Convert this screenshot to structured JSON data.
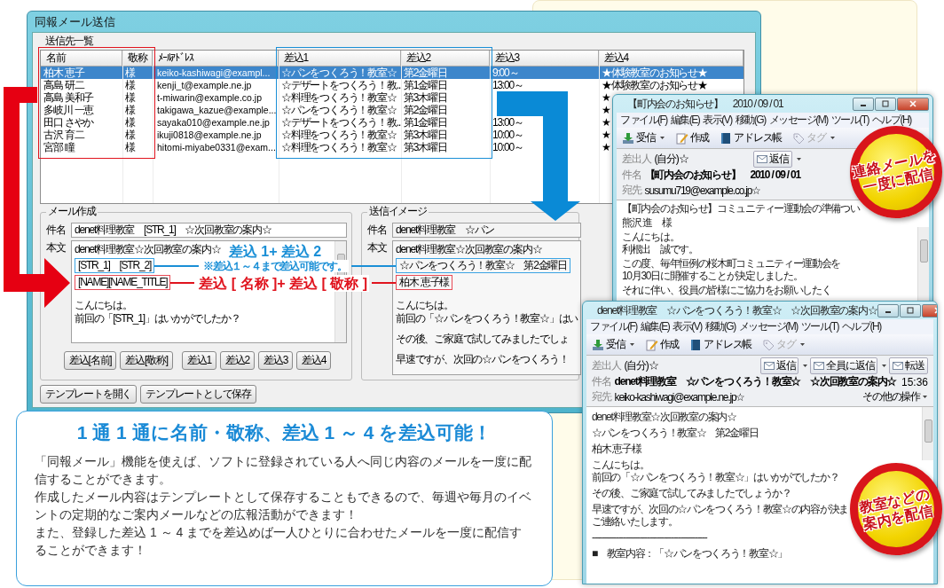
{
  "main_window": {
    "title": "同報メール送信",
    "recipient_list": {
      "label": "送信先一覧",
      "columns": [
        "名前",
        "敬称",
        "ﾒｰﾙｱﾄﾞﾚｽ",
        "差込1",
        "差込2",
        "差込3",
        "差込4"
      ],
      "rows": [
        {
          "selected": true,
          "name": "柏木 恵子",
          "honorific": "様",
          "email": "keiko-kashiwagi@exampl...",
          "insert_1": "☆パンをつくろう！教室☆",
          "insert_2": "第2金曜日",
          "insert_3": "9:00～",
          "insert_4": "★体験教室のお知らせ★"
        },
        {
          "selected": false,
          "name": "高島 研二",
          "honorific": "様",
          "email": "kenji_t@example.ne.jp",
          "insert_1": "☆デザートをつくろう！教...",
          "insert_2": "第1金曜日",
          "insert_3": "13:00～",
          "insert_4": "★体験教室のお知らせ★"
        },
        {
          "selected": false,
          "name": "高島 美和子",
          "honorific": "様",
          "email": "t-miwarin@example.co.jp",
          "insert_1": "☆料理をつくろう！教室☆",
          "insert_2": "第3木曜日",
          "insert_4": "★"
        },
        {
          "selected": false,
          "name": "多岐川 一恵",
          "honorific": "様",
          "email": "takigawa_kazue@example...",
          "insert_1": "☆パンをつくろう！教室☆",
          "insert_2": "第2金曜日",
          "insert_4": "★"
        },
        {
          "selected": false,
          "name": "田口 さやか",
          "honorific": "様",
          "email": "sayaka010@example.ne.jp",
          "insert_1": "☆デザートをつくろう！教...",
          "insert_2": "第1金曜日",
          "insert_3": "13:00～",
          "insert_4": "★"
        },
        {
          "selected": false,
          "name": "古沢 育二",
          "honorific": "様",
          "email": "ikuji0818@example.ne.jp",
          "insert_1": "☆料理をつくろう！教室☆",
          "insert_2": "第3木曜日",
          "insert_3": "10:00～",
          "insert_4": "★"
        },
        {
          "selected": false,
          "name": "宮部 瞳",
          "honorific": "様",
          "email": "hitomi-miyabe0331@exam...",
          "insert_1": "☆料理をつくろう！教室☆",
          "insert_2": "第3木曜日",
          "insert_3": "10:00～",
          "insert_4": "★"
        }
      ]
    },
    "compose": {
      "label": "メール作成",
      "subject_label": "件名",
      "subject": "denet料理教室　[STR_1]　☆次回教室の案内☆",
      "body_label": "本文",
      "body": [
        {
          "kind": "line",
          "text": "denet料理教室☆次回教室の案内☆"
        },
        {
          "kind": "box",
          "text": "[STR_1]　[STR_2]",
          "color": "#3aa3e3"
        },
        {
          "kind": "box",
          "text": "[NAME][NAME_TITLE]",
          "color": "#e84a55"
        },
        {
          "kind": "blank"
        },
        {
          "kind": "line",
          "text": "こんにちは。"
        },
        {
          "kind": "line",
          "text": "前回の「[STR_1]」はいかがでしたか？"
        }
      ],
      "buttons": [
        "差込[名前]",
        "差込[敬称]",
        "差込1",
        "差込2",
        "差込3",
        "差込4"
      ]
    },
    "preview": {
      "label": "送信イメージ",
      "subject_label": "件名",
      "subject": "denet料理教室　☆パン",
      "body_label": "本文",
      "body": [
        {
          "kind": "line",
          "text": "denet料理教室☆次回教室の案内☆"
        },
        {
          "kind": "box",
          "text": "☆パンをつくろう！教室☆　第2金曜日",
          "color": "#3aa3e3"
        },
        {
          "kind": "box",
          "text": "柏木 恵子様",
          "color": "#e84a55"
        },
        {
          "kind": "blank"
        },
        {
          "kind": "line",
          "text": "こんにちは。"
        },
        {
          "kind": "line",
          "text": "前回の「☆パンをつくろう！教室☆」はい"
        },
        {
          "kind": "blank"
        },
        {
          "kind": "line",
          "text": "その後、ご家庭で試してみましたでしょ"
        },
        {
          "kind": "blank"
        },
        {
          "kind": "line",
          "text": "早速ですが、次回の☆パンをつくろう！"
        }
      ]
    },
    "buttons": [
      "テンプレートを開く",
      "テンプレートとして保存"
    ]
  },
  "annotations": [
    {
      "title": "差込 1+ 差込 2",
      "note": "※差込１～４まで差込可能です。",
      "color": "#1a8fd6"
    },
    {
      "title": "差込 [ 名称 ]+ 差込 [ 敬称 ]",
      "color": "#e0141e"
    }
  ],
  "info": {
    "heading": "1 通 1 通に名前・敬称、差込 1 ～ 4 を差込可能！",
    "paragraphs": [
      "「同報メール」機能を使えば、ソフトに登録されている人へ同じ内容のメールを一度に配信することができます。",
      "作成したメール内容はテンプレートとして保存することもできるので、毎週や毎月のイベントの定期的なご案内メールなどの広報活動ができます！",
      "また、登録した差込 1 ～ 4 までを差込めば一人ひとりに合わせたメールを一度に配信することができます！"
    ]
  },
  "mail_windows": [
    {
      "title": "【町内会のお知らせ】　2010 / 09 / 01",
      "menu": [
        "ファイル(F)",
        "編集(E)",
        "表示(V)",
        "移動(G)",
        "メッセージ(M)",
        "ツール(T)",
        "ヘルプ(H)"
      ],
      "toolbar": [
        {
          "kind": "receive",
          "label": "受信",
          "dropdown": true,
          "disabled": false
        },
        {
          "kind": "compose",
          "label": "作成",
          "dropdown": false,
          "disabled": false
        },
        {
          "kind": "address_book",
          "label": "アドレス帳",
          "dropdown": false,
          "disabled": false
        },
        {
          "kind": "tag",
          "label": "タグ",
          "dropdown": true,
          "disabled": true
        }
      ],
      "from_label": "差出人",
      "from": "(自分)☆",
      "actions": [
        {
          "label": "返信",
          "dropdown": true
        }
      ],
      "subject_label": "件名",
      "subject": "【町内会のお知らせ】　2010 / 09 / 01",
      "to_label": "宛先",
      "to": "susumu719@example.co.jp☆",
      "paragraphs": [
        [
          "【町内会のお知らせ】コミュニティー運動会の準備つい"
        ],
        [
          "熊沢 進　様"
        ],
        [
          "こんにちは。",
          "利根出　誠です。"
        ],
        [
          "この度、毎年恒例の桜木町コミュニティー運動会を",
          "10月30日に開催することが決定しました。"
        ],
        [
          "それに伴い、役員の皆様にご協力をお願いしたく"
        ]
      ]
    },
    {
      "title": "denet料理教室　☆パンをつくろう！教室☆　☆次回教室の案内☆",
      "menu": [
        "ファイル(F)",
        "編集(E)",
        "表示(V)",
        "移動(G)",
        "メッセージ(M)",
        "ツール(T)",
        "ヘルプ(H)"
      ],
      "toolbar": [
        {
          "kind": "receive",
          "label": "受信",
          "dropdown": true,
          "disabled": false
        },
        {
          "kind": "compose",
          "label": "作成",
          "dropdown": false,
          "disabled": false
        },
        {
          "kind": "address_book",
          "label": "アドレス帳",
          "dropdown": false,
          "disabled": false
        },
        {
          "kind": "tag",
          "label": "タグ",
          "dropdown": true,
          "disabled": true
        }
      ],
      "from_label": "差出人",
      "from": "(自分)☆",
      "actions": [
        {
          "label": "返信",
          "dropdown": true
        },
        {
          "label": "全員に返信",
          "dropdown": true
        },
        {
          "label": "転送",
          "dropdown": false
        }
      ],
      "subject_label": "件名",
      "subject": "denet料理教室　☆パンをつくろう！教室☆　☆次回教室の案内☆",
      "time": "15:36",
      "to_label": "宛先",
      "to": "keiko-kashiwagi@example.ne.jp☆",
      "more": "その他の操作",
      "paragraphs": [
        [
          "denet料理教室☆次回教室の案内☆"
        ],
        [
          "☆パンをつくろう！教室☆　第2金曜日"
        ],
        [
          "柏木 恵子様"
        ],
        [
          "こんにちは。",
          "前回の「☆パンをつくろう！教室☆」はいかがでしたか？"
        ],
        [
          "その後、ご家庭で試してみましたでしょうか？"
        ],
        [
          "早速ですが、次回の☆パンをつくろう！教室☆の内容が決ま",
          "ご連絡いたします。"
        ],
        [
          "------------------------------------------------"
        ],
        [
          "■　教室内容：「☆パンをつくろう！教室☆」"
        ]
      ]
    }
  ],
  "badges": [
    {
      "lines": [
        "連絡メールを",
        "一度に配信"
      ]
    },
    {
      "lines": [
        "教室などの",
        "案内を配信"
      ]
    }
  ]
}
